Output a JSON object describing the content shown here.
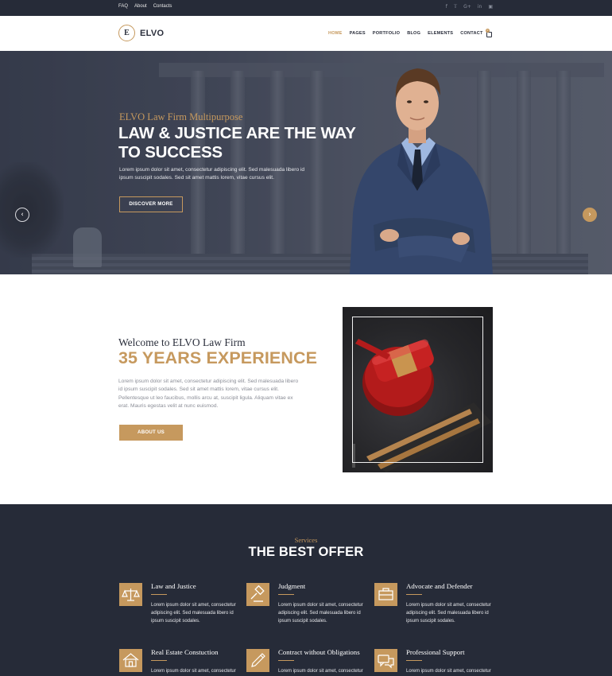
{
  "topbar": {
    "links": [
      "FAQ",
      "About",
      "Contacts"
    ],
    "social": [
      "facebook-icon",
      "twitter-icon",
      "google-plus-icon",
      "linkedin-icon",
      "instagram-icon"
    ]
  },
  "header": {
    "logo_letter": "E",
    "logo_text": "ELVO",
    "nav": [
      "HOME",
      "PAGES",
      "PORTFOLIO",
      "BLOG",
      "ELEMENTS",
      "CONTACT"
    ],
    "active_nav": "HOME",
    "cart_count": "0"
  },
  "hero": {
    "subtitle": "ELVO Law Firm Multipurpose",
    "title": "LAW & JUSTICE ARE THE WAY TO SUCCESS",
    "text": "Lorem ipsum dolor sit amet, consectetur adipiscing elit. Sed malesuada libero id ipsum suscipit sodales. Sed sit amet mattis lorem, vitae cursus elit.",
    "button": "DISCOVER MORE",
    "prev_icon": "chevron-left-icon",
    "next_icon": "chevron-right-icon"
  },
  "about": {
    "subtitle": "Welcome to ELVO Law Firm",
    "title": "35 YEARS EXPERIENCE",
    "text": "Lorem ipsum dolor sit amet, consectetur adipiscing elit. Sed malesuada libero id ipsum suscipit sodales. Sed sit amet mattis lorem, vitae cursus elit. Pellentesque ut leo faucibus, mollis arcu at, suscipit ligula. Aliquam vitae ex erat. Mauris egestas velit at nunc euismod.",
    "button": "ABOUT US"
  },
  "services": {
    "subtitle": "Services",
    "title": "THE BEST OFFER",
    "items": [
      {
        "name": "Law and Justice",
        "icon": "scales-icon",
        "desc": "Lorem ipsum dolor sit amet, consectetur adipiscing elit. Sed malesuada libero id ipsum suscipit sodales."
      },
      {
        "name": "Judgment",
        "icon": "gavel-icon",
        "desc": "Lorem ipsum dolor sit amet, consectetur adipiscing elit. Sed malesuada libero id ipsum suscipit sodales."
      },
      {
        "name": "Advocate and Defender",
        "icon": "briefcase-icon",
        "desc": "Lorem ipsum dolor sit amet, consectetur adipiscing elit. Sed malesuada libero id ipsum suscipit sodales."
      },
      {
        "name": "Real Estate Constuction",
        "icon": "house-icon",
        "desc": "Lorem ipsum dolor sit amet, consectetur"
      },
      {
        "name": "Contract without Obligations",
        "icon": "pen-icon",
        "desc": "Lorem ipsum dolor sit amet, consectetur"
      },
      {
        "name": "Professional Support",
        "icon": "chat-icon",
        "desc": "Lorem ipsum dolor sit amet, consectetur"
      }
    ]
  },
  "colors": {
    "accent": "#c6995e",
    "dark": "#262b38",
    "text_dark": "#2b2f3c"
  }
}
